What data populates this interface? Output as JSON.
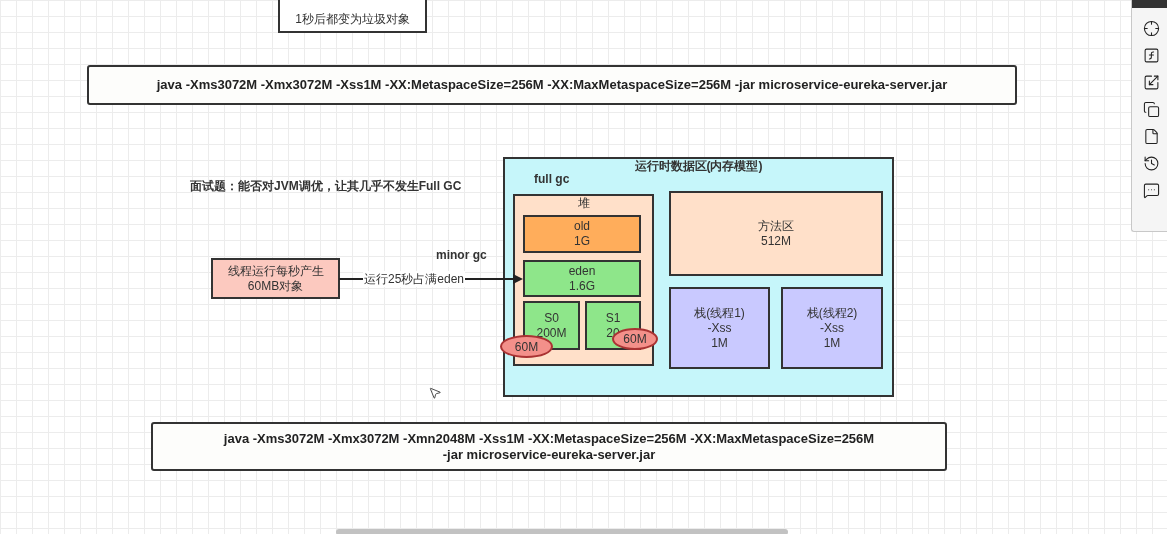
{
  "canvas": {
    "nodes": [
      {
        "kind": "note",
        "lines": [
          "1秒后都变为垃圾对象"
        ]
      },
      {
        "kind": "command",
        "lines": [
          "java -Xms3072M -Xmx3072M -Xss1M -XX:MetaspaceSize=256M -XX:MaxMetaspaceSize=256M  -jar microservice-eureka-server.jar"
        ]
      },
      {
        "kind": "label",
        "lines": [
          "面试题：能否对JVM调优，让其几乎不发生Full GC"
        ]
      },
      {
        "kind": "label",
        "lines": [
          "minor gc"
        ]
      },
      {
        "kind": "region",
        "color": "#c6f6fa",
        "lines": [
          "运行时数据区(内存模型)"
        ],
        "children": [
          {
            "kind": "label",
            "lines": [
              "full gc"
            ]
          },
          {
            "kind": "container",
            "color": "#ffe0c9",
            "lines": [
              "堆"
            ],
            "children": [
              {
                "kind": "block",
                "color": "#ffad5b",
                "lines": [
                  "old",
                  "1G"
                ]
              },
              {
                "kind": "block",
                "color": "#8ee68a",
                "lines": [
                  "eden",
                  "1.6G"
                ]
              },
              {
                "kind": "block",
                "color": "#8ee68a",
                "lines": [
                  "S0",
                  "200M"
                ]
              },
              {
                "kind": "block",
                "color": "#8ee68a",
                "lines": [
                  "S1",
                  "20"
                ]
              },
              {
                "kind": "bubble",
                "color": "#f3908a",
                "lines": [
                  "60M"
                ]
              },
              {
                "kind": "bubble",
                "color": "#f3908a",
                "lines": [
                  "60M"
                ]
              }
            ]
          },
          {
            "kind": "block",
            "color": "#ffe0c9",
            "lines": [
              "方法区",
              "512M"
            ]
          },
          {
            "kind": "block",
            "color": "#c9c9ff",
            "lines": [
              "栈(线程1)",
              "-Xss",
              "1M"
            ]
          },
          {
            "kind": "block",
            "color": "#c9c9ff",
            "lines": [
              "栈(线程2)",
              "-Xss",
              "1M"
            ]
          }
        ]
      },
      {
        "kind": "block",
        "color": "#fcc9bf",
        "lines": [
          "线程运行每秒产生",
          "60MB对象"
        ]
      },
      {
        "kind": "edge",
        "lines": [
          "运行25秒占满eden"
        ]
      },
      {
        "kind": "command",
        "lines": [
          "java -Xms3072M -Xmx3072M -Xmn2048M -Xss1M -XX:MetaspaceSize=256M -XX:MaxMetaspaceSize=256M",
          "-jar microservice-eureka-server.jar"
        ]
      }
    ]
  }
}
